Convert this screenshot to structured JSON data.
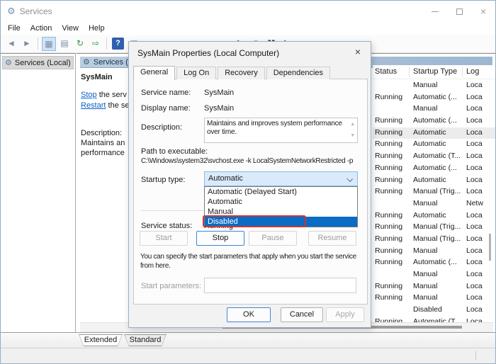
{
  "window": {
    "title": "Services"
  },
  "menu": {
    "items": [
      "File",
      "Action",
      "View",
      "Help"
    ]
  },
  "toolbar": {
    "icons": [
      {
        "name": "back-icon",
        "glyph": "◄"
      },
      {
        "name": "forward-icon",
        "glyph": "►"
      },
      {
        "type": "sep",
        "name": "toolbar-separator"
      },
      {
        "name": "console-tree-icon",
        "glyph": "▦",
        "cls": "active"
      },
      {
        "name": "properties-icon",
        "glyph": "▤"
      },
      {
        "name": "refresh-icon",
        "glyph": "↻",
        "cls": "green"
      },
      {
        "name": "export-list-icon",
        "glyph": "⇨",
        "cls": "green"
      },
      {
        "type": "sep",
        "name": "toolbar-separator"
      },
      {
        "name": "help-icon",
        "glyph": "?",
        "cls": "help"
      },
      {
        "name": "show-hide-action-pane-icon",
        "glyph": "▣"
      },
      {
        "type": "gap",
        "name": "toolbar-gap"
      },
      {
        "name": "start-service-icon",
        "glyph": "▶",
        "cls": "dark"
      },
      {
        "name": "stop-service-icon",
        "glyph": "■",
        "cls": "dark"
      },
      {
        "name": "pause-service-icon",
        "glyph": "▮▮",
        "cls": "dark"
      },
      {
        "name": "restart-service-icon",
        "glyph": "▶",
        "cls": "dark"
      }
    ]
  },
  "sidebar": {
    "item": "Services (Local)"
  },
  "details": {
    "banner": "Services (Local)",
    "service_title": "SysMain",
    "stop_link": "Stop",
    "stop_rest": " the serv",
    "restart_link": "Restart",
    "restart_rest": " the se",
    "description_label": "Description:",
    "description_lines": [
      "Maintains an",
      "performance"
    ]
  },
  "list": {
    "columns": [
      "Status",
      "Startup Type",
      "Log"
    ],
    "rows": [
      {
        "status": "",
        "startup": "Manual",
        "log": "Loca"
      },
      {
        "status": "Running",
        "startup": "Automatic (...",
        "log": "Loca"
      },
      {
        "status": "",
        "startup": "Manual",
        "log": "Loca"
      },
      {
        "status": "Running",
        "startup": "Automatic (...",
        "log": "Loca"
      },
      {
        "status": "Running",
        "startup": "Automatic",
        "log": "Loca",
        "selected": true
      },
      {
        "status": "Running",
        "startup": "Automatic",
        "log": "Loca"
      },
      {
        "status": "Running",
        "startup": "Automatic (T...",
        "log": "Loca"
      },
      {
        "status": "Running",
        "startup": "Automatic (...",
        "log": "Loca"
      },
      {
        "status": "Running",
        "startup": "Automatic",
        "log": "Loca"
      },
      {
        "status": "Running",
        "startup": "Manual (Trig...",
        "log": "Loca"
      },
      {
        "status": "",
        "startup": "Manual",
        "log": "Netw"
      },
      {
        "status": "Running",
        "startup": "Automatic",
        "log": "Loca"
      },
      {
        "status": "Running",
        "startup": "Manual (Trig...",
        "log": "Loca"
      },
      {
        "status": "Running",
        "startup": "Manual (Trig...",
        "log": "Loca"
      },
      {
        "status": "Running",
        "startup": "Manual",
        "log": "Loca"
      },
      {
        "status": "Running",
        "startup": "Automatic (...",
        "log": "Loca"
      },
      {
        "status": "",
        "startup": "Manual",
        "log": "Loca"
      },
      {
        "status": "Running",
        "startup": "Manual",
        "log": "Loca"
      },
      {
        "status": "Running",
        "startup": "Manual",
        "log": "Loca"
      },
      {
        "status": "",
        "startup": "Disabled",
        "log": "Loca"
      },
      {
        "status": "Running",
        "startup": "Automatic (T...",
        "log": "Loca"
      }
    ]
  },
  "view_tabs": {
    "extended": "Extended",
    "standard": "Standard"
  },
  "dialog": {
    "title": "SysMain Properties (Local Computer)",
    "tabs": [
      {
        "label": "General",
        "active": true
      },
      {
        "label": "Log On"
      },
      {
        "label": "Recovery"
      },
      {
        "label": "Dependencies"
      }
    ],
    "service_name_label": "Service name:",
    "service_name": "SysMain",
    "display_name_label": "Display name:",
    "display_name": "SysMain",
    "description_label": "Description:",
    "description": "Maintains and improves system performance over time.",
    "path_label": "Path to executable:",
    "path": "C:\\Windows\\system32\\svchost.exe -k LocalSystemNetworkRestricted -p",
    "startup_label": "Startup type:",
    "startup_value": "Automatic",
    "dropdown": [
      "Automatic (Delayed Start)",
      "Automatic",
      "Manual",
      "Disabled"
    ],
    "dropdown_selected": "Disabled",
    "status_label": "Service status:",
    "status_value": "Running",
    "control_buttons": [
      {
        "label": "Start",
        "enabled": false
      },
      {
        "label": "Stop",
        "enabled": true
      },
      {
        "label": "Pause",
        "enabled": false
      },
      {
        "label": "Resume",
        "enabled": false
      }
    ],
    "params_lines": [
      "You can specify the start parameters that apply when you start the service",
      "from here."
    ],
    "params_label": "Start parameters:",
    "ok": "OK",
    "cancel": "Cancel",
    "apply": "Apply"
  },
  "colors": {
    "accent": "#0078d7",
    "selection": "#0a6cc4",
    "annotation_red": "#cf3535",
    "link": "#0b61c4"
  }
}
